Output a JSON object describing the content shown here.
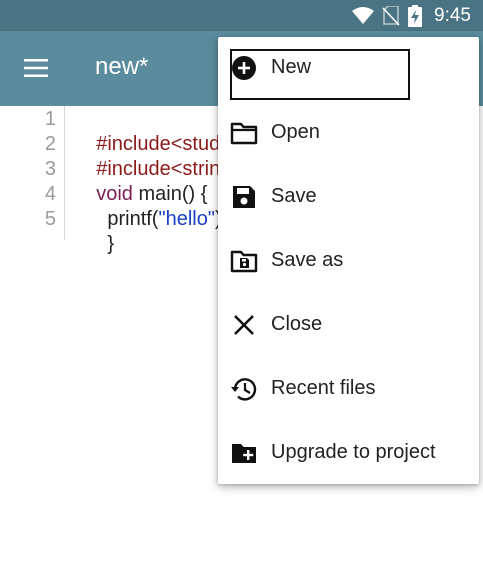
{
  "status_bar": {
    "time": "9:45",
    "icons": [
      "wifi-icon",
      "no-sim-icon",
      "battery-charging-icon"
    ]
  },
  "app_bar": {
    "menu_icon": "hamburger-menu-icon",
    "title": "new*",
    "colors": {
      "app_bar": "#5a8c9e",
      "status_bar": "#4a7483"
    }
  },
  "editor": {
    "line_numbers": [
      "1",
      "2",
      "3",
      "4",
      "5"
    ],
    "lines": [
      {
        "parts": [
          {
            "text": "#include<studio",
            "kind": "preprocessor"
          }
        ]
      },
      {
        "parts": [
          {
            "text": "#include<string",
            "kind": "preprocessor"
          }
        ]
      },
      {
        "parts": [
          {
            "text": "void",
            "kind": "keyword"
          },
          {
            "text": " main() {",
            "kind": "plain"
          }
        ]
      },
      {
        "parts": [
          {
            "text": "  printf(",
            "kind": "plain"
          },
          {
            "text": "\"hello\"",
            "kind": "string"
          },
          {
            "text": ");",
            "kind": "plain"
          }
        ]
      },
      {
        "parts": [
          {
            "text": "  }",
            "kind": "plain"
          }
        ]
      }
    ],
    "colors": {
      "preprocessor": "#8b1a1a",
      "keyword": "#7a1f55",
      "string": "#1a3fc8"
    }
  },
  "menu": {
    "items": [
      {
        "label": "New",
        "icon": "add-circle-icon",
        "focused": true
      },
      {
        "label": "Open",
        "icon": "folder-open-icon"
      },
      {
        "label": "Save",
        "icon": "save-icon"
      },
      {
        "label": "Save as",
        "icon": "save-as-folder-icon"
      },
      {
        "label": "Close",
        "icon": "close-icon"
      },
      {
        "label": "Recent files",
        "icon": "history-icon"
      },
      {
        "label": "Upgrade to project",
        "icon": "folder-add-icon"
      }
    ]
  }
}
